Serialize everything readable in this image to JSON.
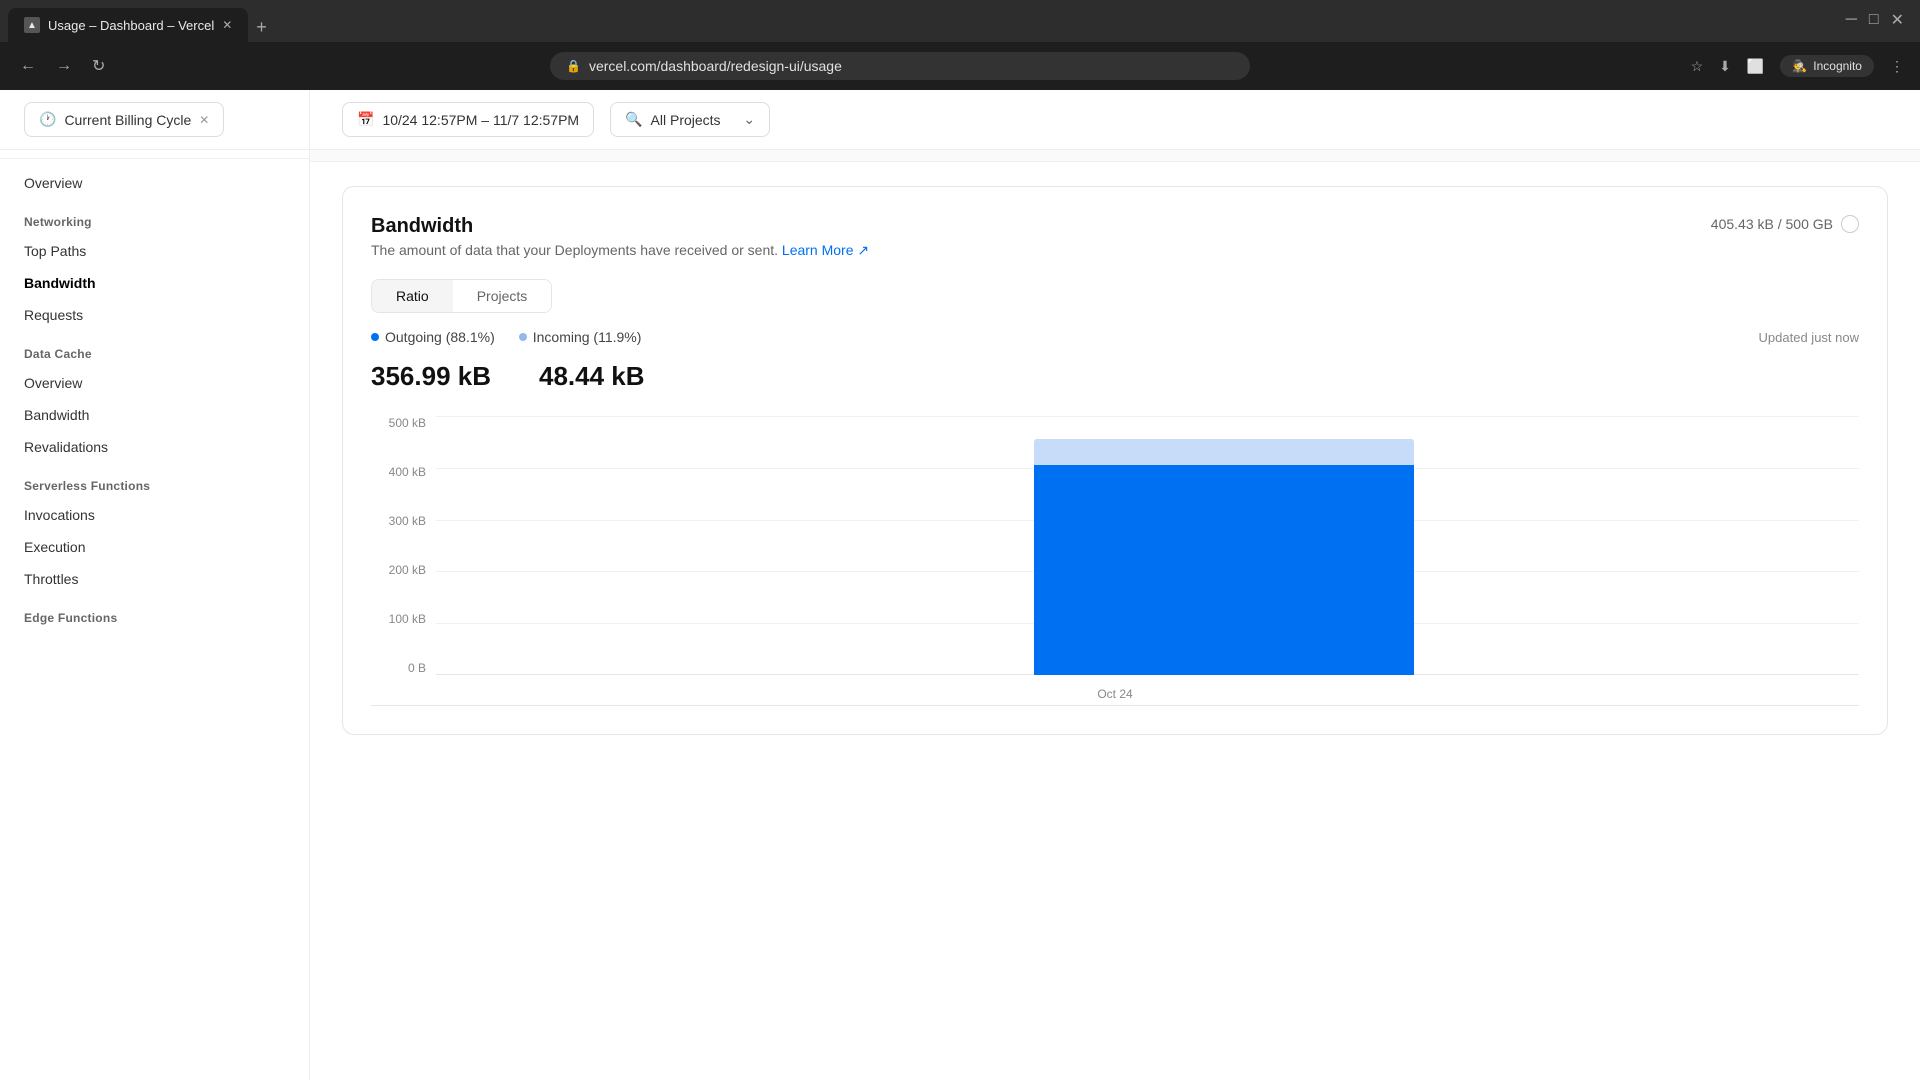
{
  "browser": {
    "tab_title": "Usage – Dashboard – Vercel",
    "url": "vercel.com/dashboard/redesign-ui/usage",
    "incognito_label": "Incognito"
  },
  "topbar": {
    "billing_cycle_label": "Current Billing Cycle",
    "date_range": "10/24 12:57PM – 11/7 12:57PM",
    "projects_placeholder": "All Projects"
  },
  "sidebar": {
    "sections": [
      {
        "items": [
          {
            "label": "Overview",
            "active": false
          }
        ]
      },
      {
        "section_label": "Networking",
        "items": [
          {
            "label": "Top Paths",
            "active": false
          },
          {
            "label": "Bandwidth",
            "active": true
          },
          {
            "label": "Requests",
            "active": false
          }
        ]
      },
      {
        "section_label": "Data Cache",
        "items": [
          {
            "label": "Overview",
            "active": false
          },
          {
            "label": "Bandwidth",
            "active": false
          },
          {
            "label": "Revalidations",
            "active": false
          }
        ]
      },
      {
        "section_label": "Serverless Functions",
        "items": [
          {
            "label": "Invocations",
            "active": false
          },
          {
            "label": "Execution",
            "active": false
          },
          {
            "label": "Throttles",
            "active": false
          }
        ]
      },
      {
        "section_label": "Edge Functions",
        "items": []
      }
    ]
  },
  "bandwidth": {
    "title": "Bandwidth",
    "description": "The amount of data that your Deployments have received or sent.",
    "learn_more_text": "Learn More",
    "usage_label": "405.43 kB / 500 GB",
    "tabs": [
      "Ratio",
      "Projects"
    ],
    "active_tab": "Ratio",
    "updated_text": "Updated just now",
    "legend": [
      {
        "label": "Outgoing (88.1%)",
        "color": "#0070f3"
      },
      {
        "label": "Incoming (11.9%)",
        "color": "#94b8e8"
      }
    ],
    "outgoing_value": "356.99 kB",
    "incoming_value": "48.44 kB",
    "chart": {
      "y_labels": [
        "500 kB",
        "400 kB",
        "300 kB",
        "200 kB",
        "100 kB",
        "0 B"
      ],
      "x_label": "Oct 24",
      "bar_height_pct": 81,
      "bar_light_top_pct": 10
    }
  }
}
